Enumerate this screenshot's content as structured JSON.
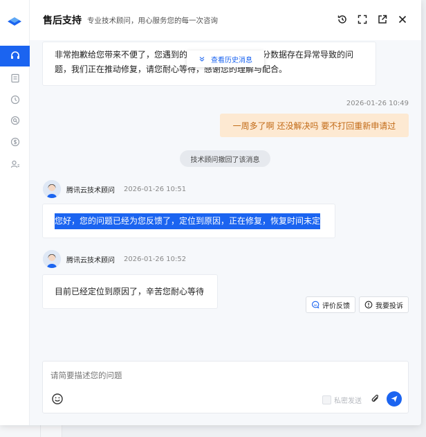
{
  "header": {
    "title": "售后支持",
    "subtitle": "专业技术顾问，用心服务您的每一次咨询"
  },
  "chat": {
    "first_message": [
      "非常抱歉给您带来不便了，您遇到的",
      "分数据存在异常导致的问",
      "题，我们正在推动修复，请您耐心等待，感谢您的理解与配合。"
    ],
    "history_button": "查看历史消息",
    "user_timestamp": "2026-01-26 10:49",
    "user_message": "一周多了啊 还没解决吗 要不打回重新申请过",
    "recall_notice": "技术顾问撤回了该消息",
    "agent_messages": [
      {
        "name": "腾讯云技术顾问",
        "time": "2026-01-26 10:51",
        "text": "您好，您的问题已经为您反馈了，定位到原因，正在修复，恢复时间未定"
      },
      {
        "name": "腾讯云技术顾问",
        "time": "2026-01-26 10:52",
        "text": "目前已经定位到原因了，辛苦您耐心等待"
      }
    ]
  },
  "feedback": {
    "rate_label": "评价反馈",
    "complain_label": "我要投诉"
  },
  "composer": {
    "placeholder": "请简要描述您的问题",
    "private_label": "私密发送"
  },
  "icons": {
    "rail": [
      "headset-icon",
      "document-icon",
      "history-icon",
      "search-service-icon",
      "dollar-icon",
      "user-group-icon"
    ],
    "header_actions": [
      "history-icon",
      "fullscreen-icon",
      "popout-icon",
      "close-icon"
    ]
  },
  "colors": {
    "accent": "#1b64f0",
    "user_bubble_bg": "#fde9d2",
    "user_bubble_text": "#c26a16"
  }
}
